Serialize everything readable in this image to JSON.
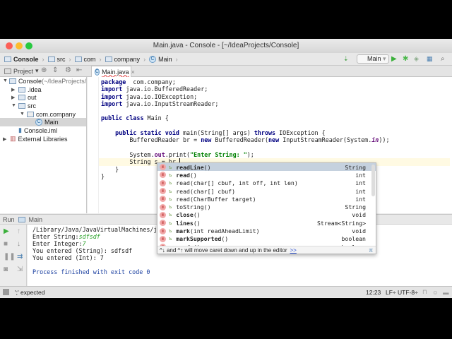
{
  "window": {
    "title": "Main.java - Console - [~/IdeaProjects/Console]"
  },
  "breadcrumb": [
    "Console",
    "src",
    "com",
    "company",
    "Main"
  ],
  "toolbar": {
    "run_config": "Main"
  },
  "project_panel": {
    "label": "Project",
    "tree": [
      {
        "label": "Console",
        "suffix": " (~/IdeaProjects/",
        "indent": 0,
        "arrow": "▼",
        "icon": "folder-icon"
      },
      {
        "label": ".idea",
        "indent": 1,
        "arrow": "▶",
        "icon": "folder-icon"
      },
      {
        "label": "out",
        "indent": 1,
        "arrow": "▶",
        "icon": "folder-icon"
      },
      {
        "label": "src",
        "indent": 1,
        "arrow": "▼",
        "icon": "folder-icon"
      },
      {
        "label": "com.company",
        "indent": 2,
        "arrow": "▼",
        "icon": "package-icon"
      },
      {
        "label": "Main",
        "indent": 3,
        "arrow": "",
        "icon": "class-icon",
        "selected": true
      },
      {
        "label": "Console.iml",
        "indent": 1,
        "arrow": "",
        "icon": "module-file-icon"
      },
      {
        "label": "External Libraries",
        "indent": 0,
        "arrow": "▶",
        "icon": "library-icon"
      }
    ]
  },
  "editor": {
    "tab": "Main.java",
    "lines": [
      [
        [
          "kw",
          "package"
        ],
        [
          "",
          "  com.company;"
        ]
      ],
      [
        [
          "kw",
          "import"
        ],
        [
          "",
          " java.io.BufferedReader;"
        ]
      ],
      [
        [
          "kw",
          "import"
        ],
        [
          "",
          " java.io.IOException;"
        ]
      ],
      [
        [
          "kw",
          "import"
        ],
        [
          "",
          " java.io.InputStreamReader;"
        ]
      ],
      [],
      [
        [
          "kw",
          "public class"
        ],
        [
          "",
          " Main {"
        ]
      ],
      [],
      [
        [
          "",
          "    "
        ],
        [
          "kw",
          "public static void"
        ],
        [
          "",
          " main(String[] args) "
        ],
        [
          "kw",
          "throws"
        ],
        [
          "",
          " IOException {"
        ]
      ],
      [
        [
          "",
          "        BufferedReader br = "
        ],
        [
          "kw",
          "new"
        ],
        [
          "",
          " BufferedReader("
        ],
        [
          "kw",
          "new"
        ],
        [
          "",
          " InputStreamReader(System."
        ],
        [
          "it",
          "in"
        ],
        [
          "",
          "));"
        ]
      ],
      [],
      [
        [
          "",
          "        System."
        ],
        [
          "fld",
          "out"
        ],
        [
          "",
          ".print("
        ],
        [
          "str",
          "\"Enter String: \""
        ],
        [
          "",
          ");"
        ]
      ],
      [
        [
          "",
          "        String s = br."
        ]
      ],
      [
        [
          "",
          "    }"
        ]
      ],
      [
        [
          "",
          "}"
        ]
      ]
    ],
    "current_line": 11
  },
  "completion": {
    "items": [
      {
        "name": "readLine",
        "params": "()",
        "type": "String",
        "bold": true
      },
      {
        "name": "read",
        "params": "()",
        "type": "int",
        "bold": true
      },
      {
        "name": "read",
        "params": "(char[] cbuf, int off, int len)",
        "type": "int"
      },
      {
        "name": "read",
        "params": "(char[] cbuf)",
        "type": "int"
      },
      {
        "name": "read",
        "params": "(CharBuffer target)",
        "type": "int"
      },
      {
        "name": "toString",
        "params": "()",
        "type": "String"
      },
      {
        "name": "close",
        "params": "()",
        "type": "void",
        "bold": true
      },
      {
        "name": "lines",
        "params": "()",
        "type": "Stream<String>",
        "bold": true
      },
      {
        "name": "mark",
        "params": "(int readAheadLimit)",
        "type": "void",
        "bold": true
      },
      {
        "name": "markSupported",
        "params": "()",
        "type": "boolean",
        "bold": true
      },
      {
        "name": "ready",
        "params": "()",
        "type": "boolean",
        "bold": true
      }
    ],
    "hint": "^↓ and ^↑ will move caret down and up in the editor",
    "hint_link": ">>",
    "pi": "π"
  },
  "run_panel": {
    "label": "Run",
    "config": "Main",
    "output": [
      [
        [
          "",
          "/Library/Java/JavaVirtualMachines/jdk1"
        ]
      ],
      [
        [
          "",
          "Enter String:"
        ],
        [
          "inp",
          "sdfsdf"
        ]
      ],
      [
        [
          "",
          "Enter Integer:"
        ],
        [
          "inp",
          "7"
        ]
      ],
      [
        [
          "",
          "You entered (String): sdfsdf"
        ]
      ],
      [
        [
          "",
          "You entered (Int): 7"
        ]
      ],
      [],
      [
        [
          "fin",
          "Process finished with exit code 0"
        ]
      ]
    ]
  },
  "status_bar": {
    "message": "';' expected",
    "position": "12:23",
    "line_sep": "LF÷",
    "encoding": "UTF-8÷"
  }
}
